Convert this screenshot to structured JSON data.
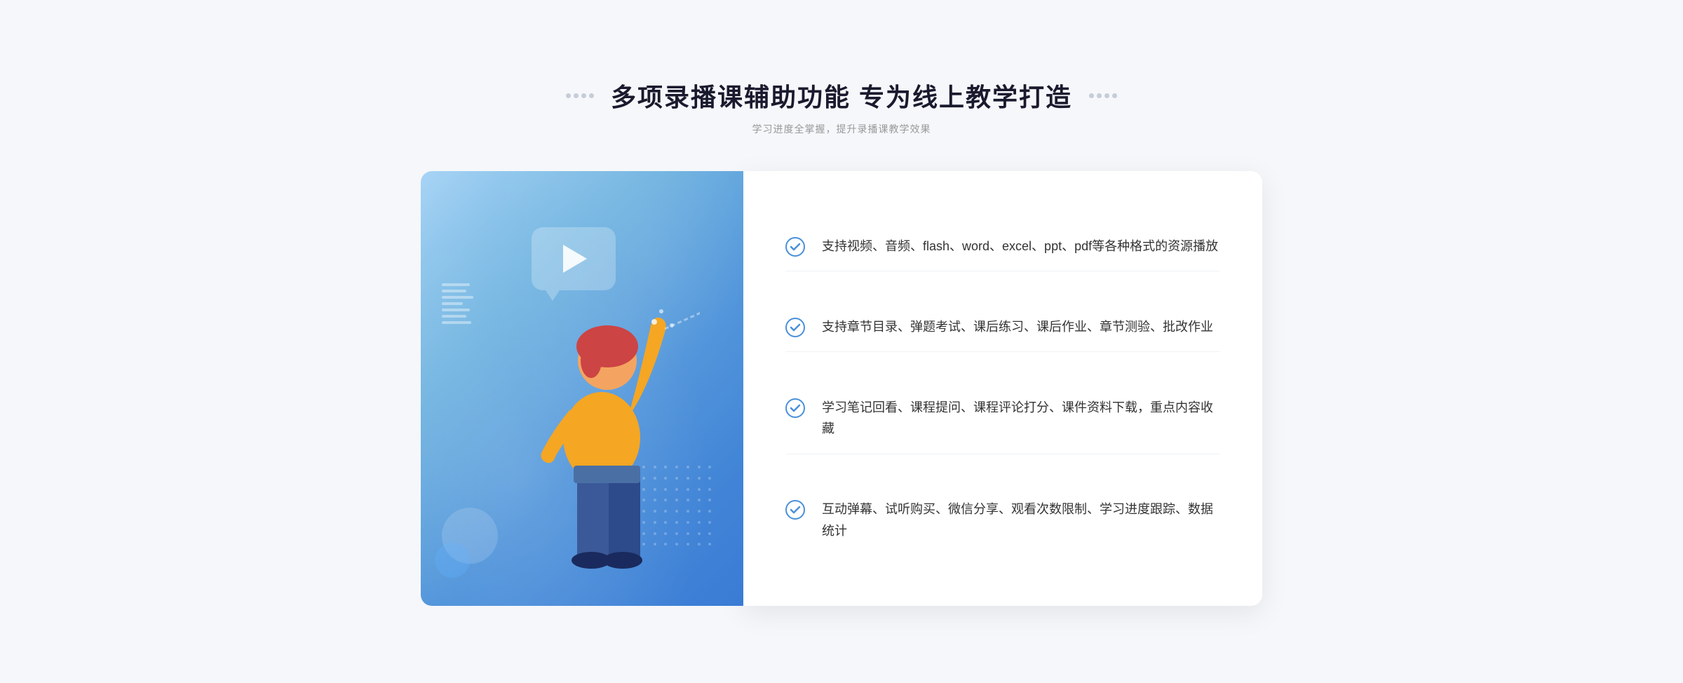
{
  "header": {
    "title": "多项录播课辅助功能 专为线上教学打造",
    "subtitle": "学习进度全掌握，提升录播课教学效果"
  },
  "features": [
    {
      "id": 1,
      "text": "支持视频、音频、flash、word、excel、ppt、pdf等各种格式的资源播放"
    },
    {
      "id": 2,
      "text": "支持章节目录、弹题考试、课后练习、课后作业、章节测验、批改作业"
    },
    {
      "id": 3,
      "text": "学习笔记回看、课程提问、课程评论打分、课件资料下载，重点内容收藏"
    },
    {
      "id": 4,
      "text": "互动弹幕、试听购买、微信分享、观看次数限制、学习进度跟踪、数据统计"
    }
  ]
}
